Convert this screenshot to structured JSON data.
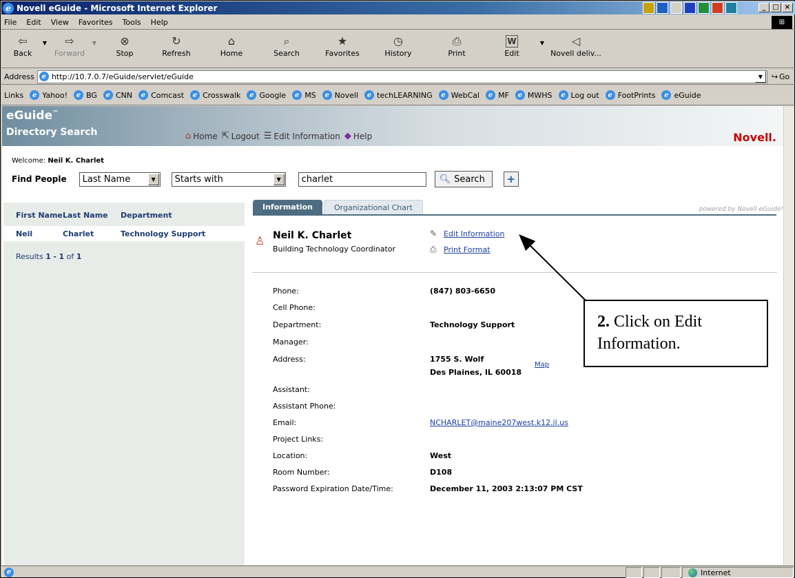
{
  "window": {
    "title": "Novell eGuide - Microsoft Internet Explorer",
    "controls": {
      "minimize": "_",
      "restore": "□",
      "close": "×"
    }
  },
  "menu": [
    "File",
    "Edit",
    "View",
    "Favorites",
    "Tools",
    "Help"
  ],
  "toolbar": [
    {
      "label": "Back",
      "icon": "back-arrow-icon",
      "glyph": "⇦",
      "disabled": false
    },
    {
      "label": "Forward",
      "icon": "forward-arrow-icon",
      "glyph": "⇨",
      "disabled": true
    },
    {
      "label": "Stop",
      "icon": "stop-icon",
      "glyph": "⊗",
      "disabled": false
    },
    {
      "label": "Refresh",
      "icon": "refresh-icon",
      "glyph": "↻",
      "disabled": false
    },
    {
      "label": "Home",
      "icon": "home-icon",
      "glyph": "⌂",
      "disabled": false
    },
    {
      "label": "Search",
      "icon": "search-icon",
      "glyph": "⌕",
      "disabled": false
    },
    {
      "label": "Favorites",
      "icon": "favorites-icon",
      "glyph": "★",
      "disabled": false
    },
    {
      "label": "History",
      "icon": "history-icon",
      "glyph": "◷",
      "disabled": false
    },
    {
      "label": "Print",
      "icon": "print-icon",
      "glyph": "⎙",
      "disabled": false
    },
    {
      "label": "Edit",
      "icon": "edit-word-icon",
      "glyph": "W",
      "disabled": false
    },
    {
      "label": "Novell deliv...",
      "icon": "novell-deliver-icon",
      "glyph": "◁",
      "disabled": false
    }
  ],
  "address": {
    "label": "Address",
    "url": "http://10.7.0.7/eGuide/servlet/eGuide",
    "go": "Go"
  },
  "links": {
    "label": "Links",
    "items": [
      "Yahoo!",
      "BG",
      "CNN",
      "Comcast",
      "Crosswalk",
      "Google",
      "MS",
      "Novell",
      "techLEARNING",
      "WebCal",
      "MF",
      "MWHS",
      "Log out",
      "FootPrints",
      "eGuide"
    ]
  },
  "eguide": {
    "title": "eGuide",
    "tm": "™",
    "subtitle": "Directory Search",
    "nav": [
      "Home",
      "Logout",
      "Edit Information",
      "Help"
    ],
    "brand": "Novell."
  },
  "welcome": {
    "label": "Welcome:",
    "name": "Neil K. Charlet"
  },
  "find": {
    "label": "Find People",
    "field": "Last Name",
    "operator": "Starts with",
    "query": "charlet",
    "search_label": "Search",
    "add_label": "+"
  },
  "results": {
    "columns": [
      "First Name",
      "Last Name",
      "Department"
    ],
    "rows": [
      {
        "first": "Neil",
        "last": "Charlet",
        "department": "Technology Support"
      }
    ],
    "summary": {
      "prefix": "Results",
      "start": "1",
      "dash": "-",
      "end": "1",
      "of": "of",
      "total": "1"
    }
  },
  "tabs": {
    "active": "Information",
    "inactive": "Organizational Chart",
    "powered_prefix": "powered by",
    "powered_brand": "Novell eGuide!"
  },
  "person": {
    "name": "Neil K. Charlet",
    "title": "Building Technology Coordinator",
    "edit_link": "Edit Information",
    "print_link": "Print Format"
  },
  "fields": [
    {
      "label": "Phone:",
      "value": "(847) 803-6650"
    },
    {
      "label": "Cell Phone:",
      "value": ""
    },
    {
      "label": "Department:",
      "value": "Technology Support"
    },
    {
      "label": "Manager:",
      "value": ""
    },
    {
      "label": "Address:",
      "value": "1755 S. Wolf",
      "value2": "Des Plaines, IL 60018",
      "map": "Map"
    },
    {
      "label": "Assistant:",
      "value": ""
    },
    {
      "label": "Assistant Phone:",
      "value": ""
    },
    {
      "label": "Email:",
      "value": "NCHARLET@maine207west.k12.il.us"
    },
    {
      "label": "Project Links:",
      "value": ""
    },
    {
      "label": "Location:",
      "value": "West"
    },
    {
      "label": "Room Number:",
      "value": "D108"
    },
    {
      "label": "Password Expiration Date/Time:",
      "value": "December 11, 2003 2:13:07 PM CST"
    }
  ],
  "callout": {
    "step": "2.",
    "text": "Click on Edit Information."
  },
  "status": {
    "zone": "Internet"
  }
}
